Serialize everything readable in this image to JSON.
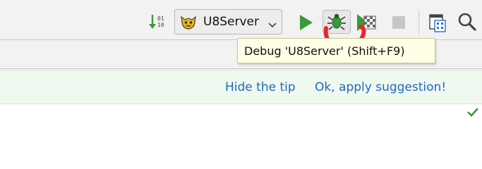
{
  "toolbar": {
    "sort_icon_text": "01\n10",
    "run_config": {
      "label": "U8Server",
      "icon": "tomcat-icon",
      "dropdown_icon": "chevron-down-icon"
    },
    "buttons": [
      {
        "name": "run",
        "icon": "play-icon",
        "color": "#3a9a3a"
      },
      {
        "name": "debug",
        "icon": "bug-icon",
        "color": "#3a9a3a"
      },
      {
        "name": "coverage",
        "icon": "coverage-icon"
      },
      {
        "name": "stop",
        "icon": "stop-icon",
        "color": "#c6c6c6"
      },
      {
        "name": "project-structure",
        "icon": "project-structure-icon"
      },
      {
        "name": "search",
        "icon": "search-icon"
      }
    ]
  },
  "tooltip": {
    "text": "Debug 'U8Server' (Shift+F9)"
  },
  "tip_bar": {
    "hide_label": "Hide the tip",
    "apply_label": "Ok, apply suggestion!"
  },
  "editor": {
    "status_icon": "checkmark-icon",
    "status_color": "#3a9a3a"
  },
  "annotation": {
    "color": "#e8262a"
  }
}
